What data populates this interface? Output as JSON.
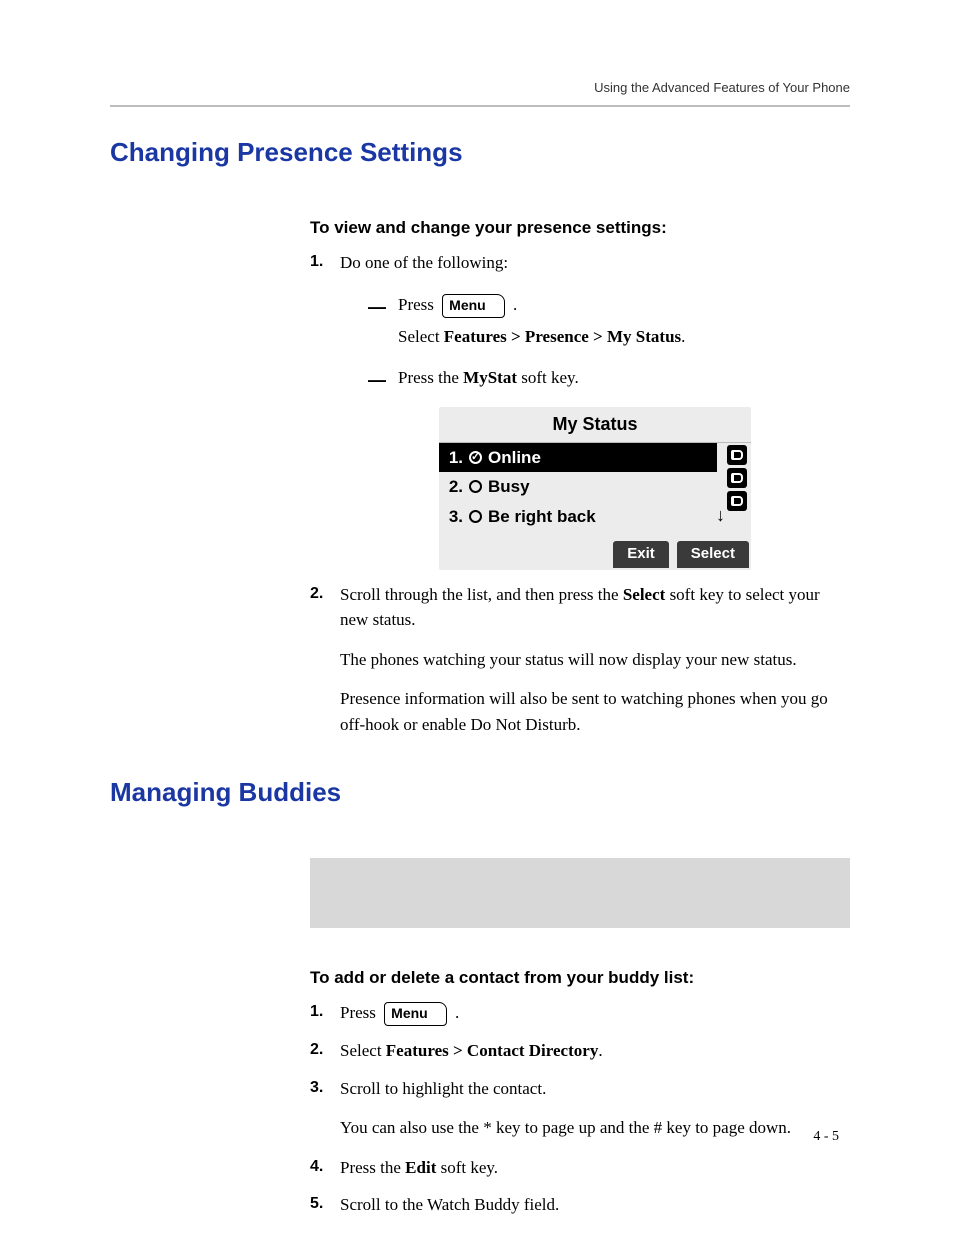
{
  "header": {
    "running_head": "Using the Advanced Features of Your Phone"
  },
  "sections": {
    "presence": {
      "title": "Changing Presence Settings",
      "subhead": "To view and change your presence settings:",
      "steps": {
        "s1_num": "1.",
        "s1_text": "Do one of the following:",
        "dash_a_press": "Press ",
        "dash_a_menu": "Menu",
        "dash_a_period": ".",
        "dash_a_select_prefix": "Select ",
        "dash_a_select_bold": "Features > Presence > My Status",
        "dash_a_select_suffix": ".",
        "dash_b_prefix": "Press the ",
        "dash_b_bold": "MyStat",
        "dash_b_suffix": " soft key.",
        "s2_num": "2.",
        "s2_prefix": "Scroll through the list, and then press the ",
        "s2_bold": "Select",
        "s2_suffix": " soft key to select your new status.",
        "s2_p2": "The phones watching your status will now display your new status.",
        "s2_p3": "Presence information will also be sent to watching phones when you go off-hook or enable Do Not Disturb."
      }
    },
    "buddies": {
      "title": "Managing Buddies",
      "subhead": "To add or delete a contact from your buddy list:",
      "steps": {
        "s1_num": "1.",
        "s1_press": "Press ",
        "s1_menu": "Menu",
        "s1_period": ".",
        "s2_num": "2.",
        "s2_prefix": "Select ",
        "s2_bold": "Features > Contact Directory",
        "s2_suffix": ".",
        "s3_num": "3.",
        "s3_text": "Scroll to highlight the contact.",
        "s3_p2": "You can also use the * key to page up and the # key to page down.",
        "s4_num": "4.",
        "s4_prefix": "Press the ",
        "s4_bold": "Edit",
        "s4_suffix": " soft key.",
        "s5_num": "5.",
        "s5_text": "Scroll to the Watch Buddy field."
      }
    }
  },
  "lcd": {
    "title": "My Status",
    "rows": {
      "r1_num": "1.",
      "r1_label": "Online",
      "r2_num": "2.",
      "r2_label": "Busy",
      "r3_num": "3.",
      "r3_label": "Be right back"
    },
    "down_arrow": "↓",
    "softkeys": {
      "exit": "Exit",
      "select": "Select"
    }
  },
  "page_number": "4 - 5"
}
